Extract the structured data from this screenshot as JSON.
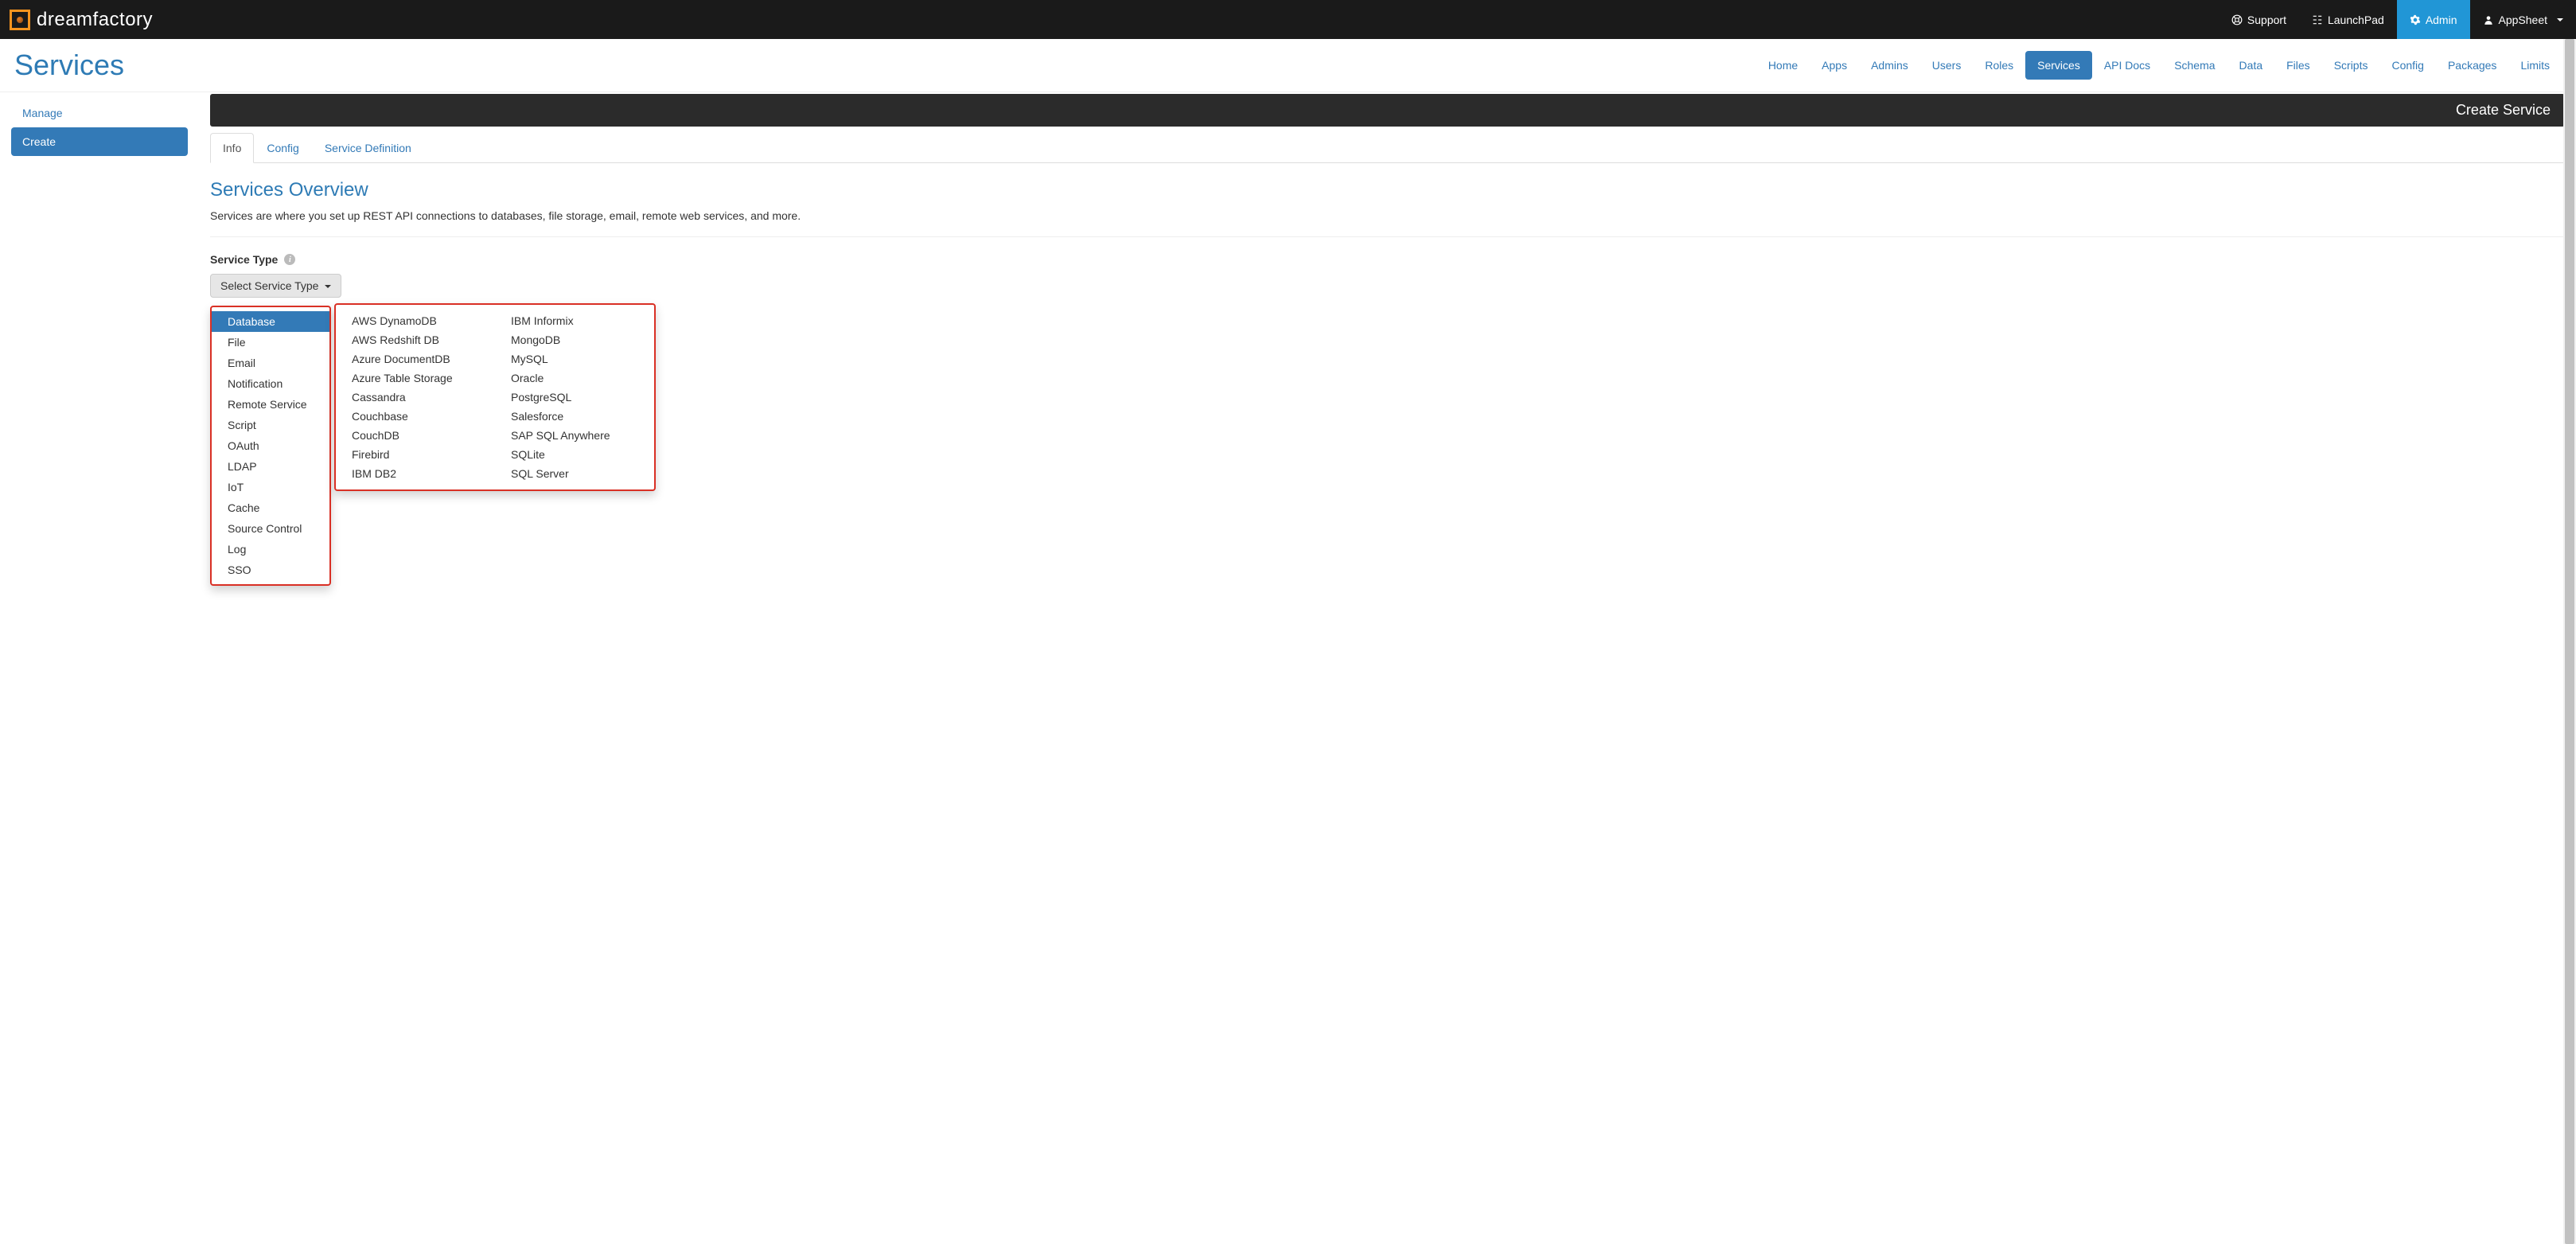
{
  "brand": "dreamfactory",
  "topbar": {
    "support": "Support",
    "launchpad": "LaunchPad",
    "admin": "Admin",
    "user": "AppSheet"
  },
  "page_title": "Services",
  "nav": [
    "Home",
    "Apps",
    "Admins",
    "Users",
    "Roles",
    "Services",
    "API Docs",
    "Schema",
    "Data",
    "Files",
    "Scripts",
    "Config",
    "Packages",
    "Limits"
  ],
  "nav_active": "Services",
  "sidebar": {
    "manage": "Manage",
    "create": "Create"
  },
  "panel_header": "Create Service",
  "tabs": {
    "info": "Info",
    "config": "Config",
    "service_def": "Service Definition"
  },
  "overview": {
    "title": "Services Overview",
    "desc": "Services are where you set up REST API connections to databases, file storage, email, remote web services, and more."
  },
  "service_type": {
    "label": "Service Type",
    "button": "Select Service Type",
    "categories": [
      "Database",
      "File",
      "Email",
      "Notification",
      "Remote Service",
      "Script",
      "OAuth",
      "LDAP",
      "IoT",
      "Cache",
      "Source Control",
      "Log",
      "SSO"
    ],
    "active_category": "Database",
    "database_options_col1": [
      "AWS DynamoDB",
      "AWS Redshift DB",
      "Azure DocumentDB",
      "Azure Table Storage",
      "Cassandra",
      "Couchbase",
      "CouchDB",
      "Firebird",
      "IBM DB2"
    ],
    "database_options_col2": [
      "IBM Informix",
      "MongoDB",
      "MySQL",
      "Oracle",
      "PostgreSQL",
      "Salesforce",
      "SAP SQL Anywhere",
      "SQLite",
      "SQL Server"
    ]
  }
}
